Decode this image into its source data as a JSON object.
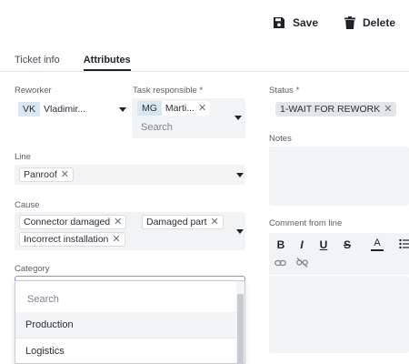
{
  "toolbar": {
    "save_label": "Save",
    "delete_label": "Delete",
    "save_icon": "floppy-disk-icon",
    "delete_icon": "trash-icon"
  },
  "tabs": [
    {
      "label": "Ticket info",
      "active": false
    },
    {
      "label": "Attributes",
      "active": true
    }
  ],
  "reworker": {
    "label": "Reworker",
    "initials": "VK",
    "name": "Vladimir..."
  },
  "task_responsible": {
    "label": "Task responsible *",
    "initials": "MG",
    "name": "Marti...",
    "search_placeholder": "Search"
  },
  "status": {
    "label": "Status *",
    "value": "1-WAIT FOR REWORK"
  },
  "notes": {
    "label": "Notes",
    "value": ""
  },
  "line": {
    "label": "Line",
    "values": [
      "Panroof"
    ]
  },
  "cause": {
    "label": "Cause",
    "values": [
      "Connector damaged",
      "Damaged part",
      "Incorrect installation"
    ]
  },
  "comment": {
    "label": "Comment from line",
    "tools": [
      "bold-icon",
      "italic-icon",
      "underline-icon",
      "strikethrough-icon",
      "text-color-icon",
      "bullet-list-icon",
      "link-icon",
      "unlink-icon"
    ],
    "tool_glyphs": {
      "bold": "B",
      "italic": "I",
      "underline": "U",
      "strike": "S",
      "color": "A"
    }
  },
  "category": {
    "label": "Category",
    "search_placeholder": "Search",
    "options": [
      "Production",
      "Logistics"
    ],
    "hovered": "Production"
  },
  "colors": {
    "field_bg": "#f1f3f5",
    "chip_initials_bg": "#d9e7ee",
    "text": "#2b2f36"
  }
}
